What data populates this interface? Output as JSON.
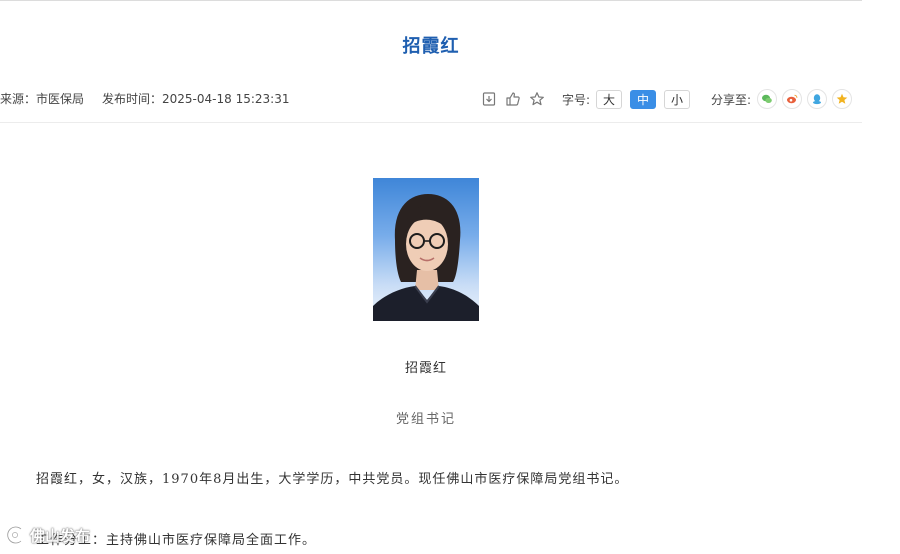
{
  "article": {
    "title": "招霞红",
    "source": "来源：市医保局",
    "publish_time": "发布时间：2025-04-18 15:23:31"
  },
  "toolbar": {
    "icons": [
      "print-icon",
      "thumbs-up-icon",
      "star-icon"
    ],
    "font_size_label": "字号:",
    "font_sizes": {
      "large": "大",
      "medium": "中",
      "small": "小",
      "active": "medium"
    },
    "share_label": "分享至:",
    "share_targets": [
      {
        "name": "wechat-share-icon",
        "color": "#5bb85b"
      },
      {
        "name": "weibo-share-icon",
        "color": "#e8603c"
      },
      {
        "name": "qq-share-icon",
        "color": "#3fa6e0"
      },
      {
        "name": "qzone-share-icon",
        "color": "#f2b320"
      }
    ]
  },
  "profile": {
    "name": "招霞红",
    "role": "党组书记"
  },
  "body": {
    "paragraph1": "招霞红，女，汉族，1970年8月出生，大学学历，中共党员。现任佛山市医疗保障局党组书记。",
    "paragraph2": "工作分工：主持佛山市医疗保障局全面工作。"
  },
  "watermark": {
    "text": "佛山发布"
  }
}
